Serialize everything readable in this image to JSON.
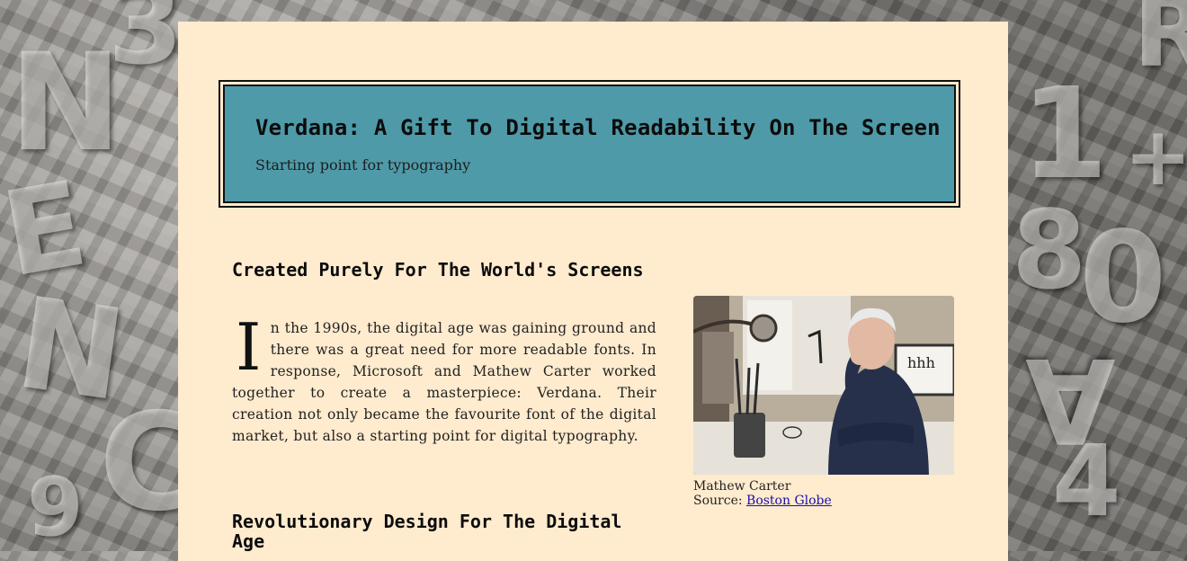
{
  "background": {
    "glyphs": [
      "N",
      "E",
      "N",
      "3",
      "9",
      "C",
      "1",
      "8",
      "0",
      "4",
      "A",
      "R",
      "+"
    ]
  },
  "header": {
    "title": "Verdana: A Gift To Digital Readability On The Screen",
    "subtitle": "Starting point for typography",
    "bg_color": "#4f9aa8"
  },
  "section1": {
    "title": "Created Purely For The World's Screens",
    "dropcap": "I",
    "body": "n the 1990s, the digital age was gaining ground and there was a great need for more readable fonts. In response, Microsoft and Mathew Carter worked together to create a masterpiece: Verdana. Their creation not only became the favourite font of the digital market, but also a starting point for digital typography."
  },
  "figure": {
    "caption_name": "Mathew Carter",
    "source_label": "Source:",
    "source_link": "Boston Globe",
    "screen_text": "hhh"
  },
  "section2": {
    "title": "Revolutionary Design For The Digital Age"
  },
  "colors": {
    "page": "#ffebce",
    "link": "#1a0dab"
  }
}
